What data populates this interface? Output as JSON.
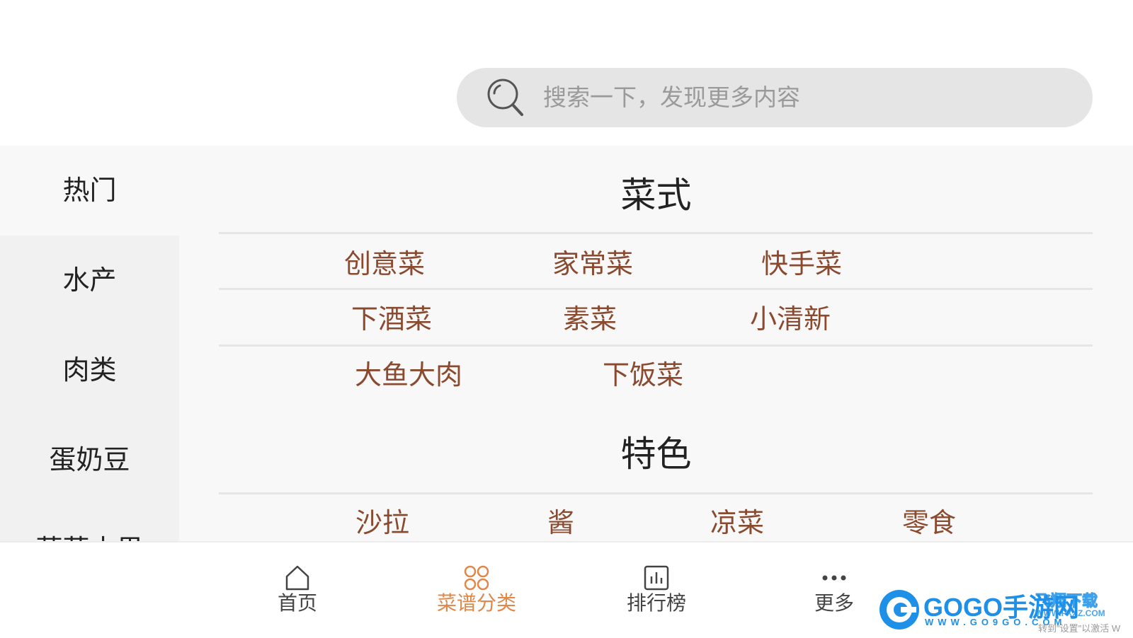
{
  "search": {
    "placeholder": "搜索一下，发现更多内容"
  },
  "sidebar": {
    "items": [
      {
        "label": "热门"
      },
      {
        "label": "水产"
      },
      {
        "label": "肉类"
      },
      {
        "label": "蛋奶豆"
      },
      {
        "label": "蔬菜水果"
      }
    ]
  },
  "sections": [
    {
      "title": "菜式",
      "rows": [
        [
          "创意菜",
          "家常菜",
          "快手菜"
        ],
        [
          "下酒菜",
          "素菜",
          "小清新"
        ],
        [
          "大鱼大肉",
          "下饭菜"
        ]
      ]
    },
    {
      "title": "特色",
      "rows": [
        [
          "沙拉",
          "酱",
          "凉菜",
          "零食"
        ]
      ]
    }
  ],
  "bottom_nav": [
    {
      "label": "首页",
      "icon": "home-icon"
    },
    {
      "label": "菜谱分类",
      "icon": "category-icon",
      "active": true
    },
    {
      "label": "排行榜",
      "icon": "ranking-icon"
    },
    {
      "label": "更多",
      "icon": "more-icon"
    }
  ],
  "watermark": {
    "brand": "GOGO手游网",
    "url": "WWW.GO9GO.COM",
    "brand2": "飞翔下载",
    "url2": "WWW.FXXZ.COM",
    "faint": "转到\"设置\"以激活 W"
  },
  "colors": {
    "accent": "#e0874a",
    "tag": "#8a4a2f",
    "watermark": "#1e90e8"
  }
}
